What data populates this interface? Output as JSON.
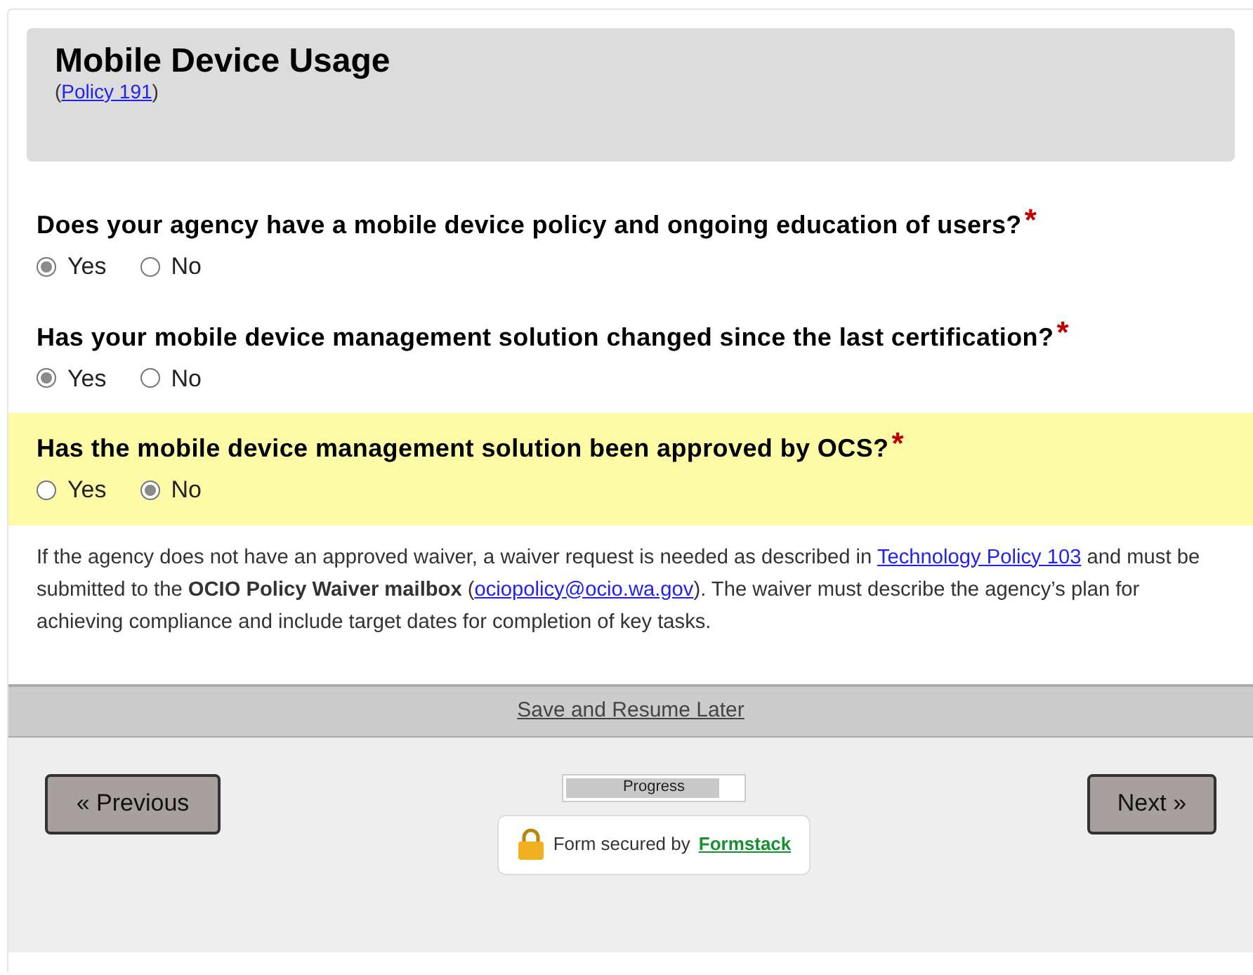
{
  "section": {
    "title": "Mobile Device Usage",
    "reference": [
      {
        "kind": "text",
        "text": "("
      },
      {
        "kind": "link",
        "text": "Policy 191"
      },
      {
        "kind": "text",
        "text": ")"
      }
    ]
  },
  "questions": [
    {
      "label": "Does your agency have a mobile device policy and ongoing education of users?",
      "required_mark": "*",
      "highlighted": false,
      "options": [
        {
          "label": "Yes",
          "selected": true
        },
        {
          "label": "No",
          "selected": false
        }
      ]
    },
    {
      "label": "Has your mobile device management solution changed since the last certification?",
      "required_mark": "*",
      "highlighted": false,
      "options": [
        {
          "label": "Yes",
          "selected": true
        },
        {
          "label": "No",
          "selected": false
        }
      ]
    },
    {
      "label": "Has the mobile device management solution been approved by OCS?",
      "required_mark": "*",
      "highlighted": true,
      "options": [
        {
          "label": "Yes",
          "selected": false
        },
        {
          "label": "No",
          "selected": true
        }
      ]
    }
  ],
  "note": [
    {
      "kind": "text",
      "text": "If the agency does not have an approved waiver, a waiver request is needed as described in "
    },
    {
      "kind": "link",
      "text": "Technology Policy 103"
    },
    {
      "kind": "text",
      "text": " and must be submitted to the **OCIO Policy Waiver mailbox** ("
    },
    {
      "kind": "link",
      "text": "ociopolicy@ocio.wa.gov"
    },
    {
      "kind": "text",
      "text": "). The waiver must describe the agency’s plan for achieving compliance and include target dates for completion of key tasks."
    }
  ],
  "save_link": "Save and Resume Later",
  "previous_button": "« Previous",
  "next_button": "Next »",
  "progress": {
    "label": "Progress",
    "level": 0.87
  },
  "security": {
    "text": "Form secured by",
    "brand": "Formstack"
  }
}
